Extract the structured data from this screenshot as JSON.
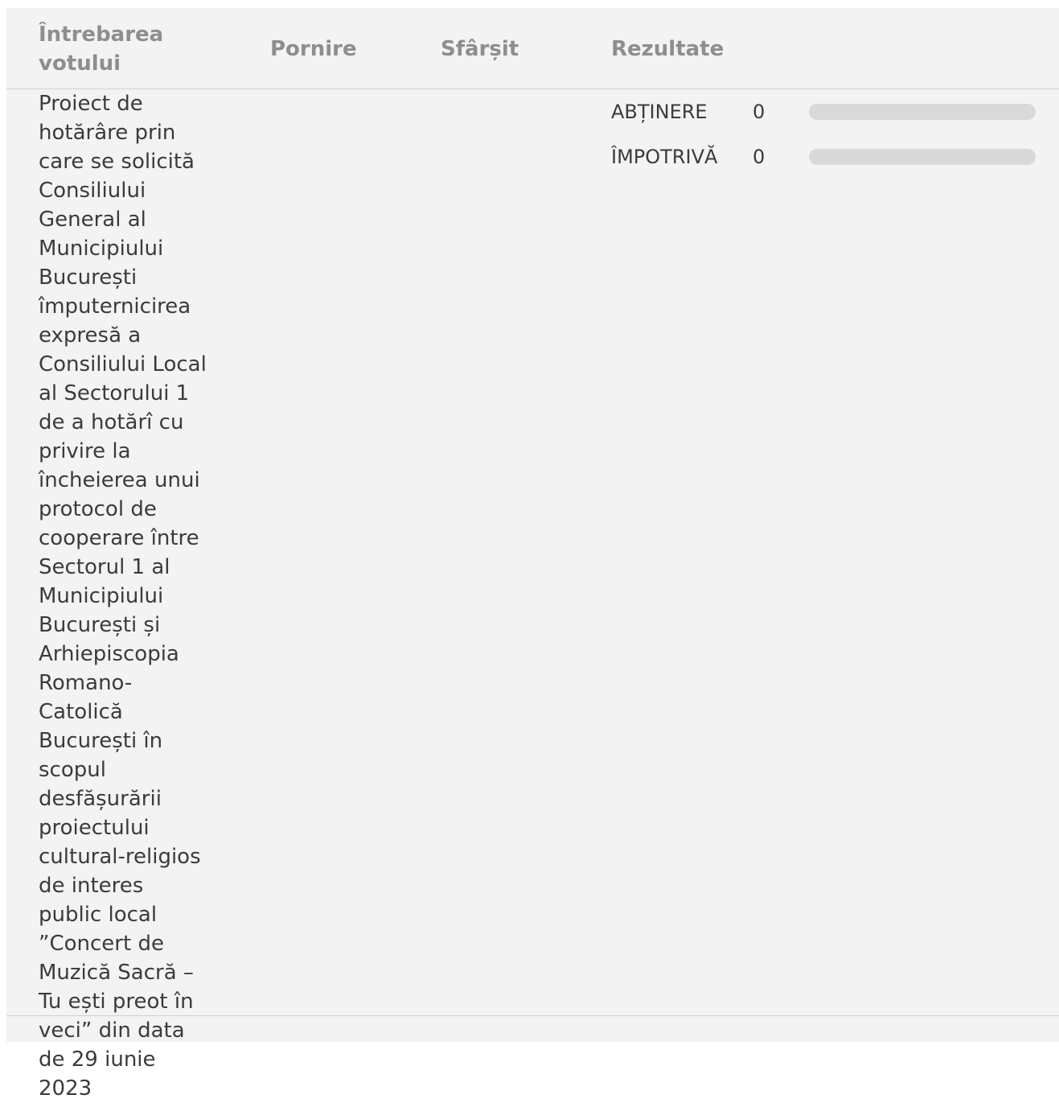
{
  "table": {
    "headers": {
      "question": "Întrebarea votului",
      "start": "Pornire",
      "end": "Sfârșit",
      "results": "Rezultate"
    },
    "rows": [
      {
        "question": "Proiect de hotărâre prin care se solicită Consiliului General al Municipiului București împuternicirea expresă a Consiliului Local al Sectorului 1 de a hotărî cu privire la încheierea unui protocol de cooperare între Sectorul 1 al Municipiului București și Arhiepiscopia Romano-Catolică București în scopul desfășurării proiectului cultural-religios de interes public local ”Concert de Muzică Sacră – Tu ești preot în veci” din data de 29 iunie 2023",
        "start": "",
        "end": "",
        "results": [
          {
            "label": "ABȚINERE",
            "count": "0",
            "fraction": 0
          },
          {
            "label": "ÎMPOTRIVĂ",
            "count": "0",
            "fraction": 0
          }
        ]
      }
    ]
  }
}
